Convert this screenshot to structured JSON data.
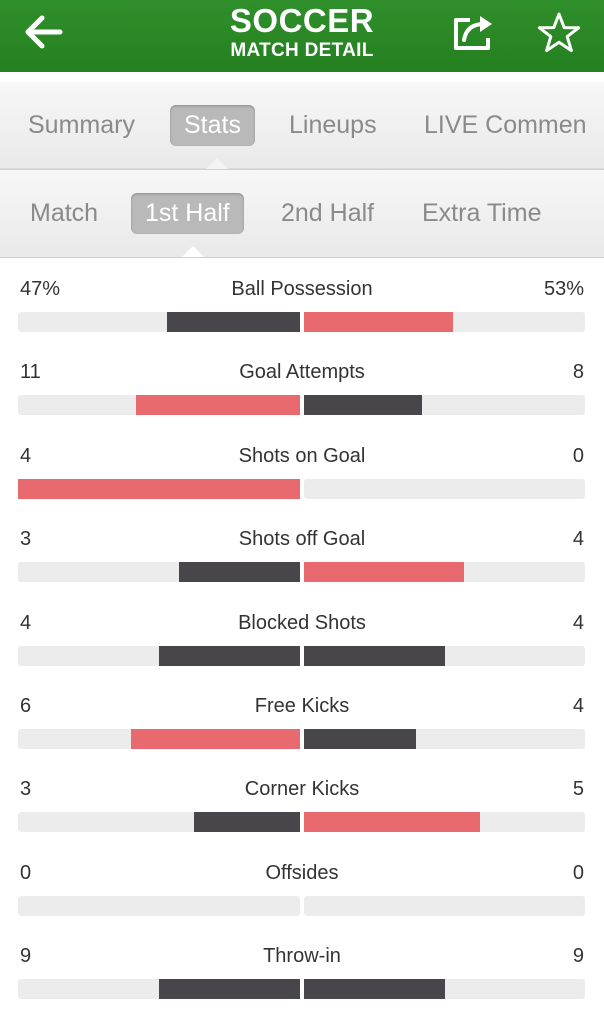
{
  "header": {
    "title": "SOCCER",
    "subtitle": "MATCH DETAIL",
    "icons": [
      "back-arrow-icon",
      "share-icon",
      "star-icon"
    ]
  },
  "tabs": [
    {
      "label": "Summary",
      "active": false
    },
    {
      "label": "Stats",
      "active": true
    },
    {
      "label": "Lineups",
      "active": false
    },
    {
      "label": "LIVE Commen",
      "active": false
    }
  ],
  "periods": [
    {
      "label": "Match",
      "active": false
    },
    {
      "label": "1st Half",
      "active": true
    },
    {
      "label": "2nd Half",
      "active": false
    },
    {
      "label": "Extra Time",
      "active": false
    }
  ],
  "colors": {
    "header_green": "#2a8a25",
    "bar_dark": "#48464a",
    "bar_red": "#e86a6e",
    "track": "#ececec"
  },
  "stats": [
    {
      "label": "Ball Possession",
      "left": "47%",
      "right": "53%",
      "left_fill": 0.47,
      "right_fill": 0.53,
      "left_color": "dark",
      "right_color": "red"
    },
    {
      "label": "Goal Attempts",
      "left": "11",
      "right": "8",
      "left_fill": 0.58,
      "right_fill": 0.42,
      "left_color": "red",
      "right_color": "dark"
    },
    {
      "label": "Shots on Goal",
      "left": "4",
      "right": "0",
      "left_fill": 1.0,
      "right_fill": 0.0,
      "left_color": "red",
      "right_color": "dark"
    },
    {
      "label": "Shots off Goal",
      "left": "3",
      "right": "4",
      "left_fill": 0.43,
      "right_fill": 0.57,
      "left_color": "dark",
      "right_color": "red"
    },
    {
      "label": "Blocked Shots",
      "left": "4",
      "right": "4",
      "left_fill": 0.5,
      "right_fill": 0.5,
      "left_color": "dark",
      "right_color": "dark"
    },
    {
      "label": "Free Kicks",
      "left": "6",
      "right": "4",
      "left_fill": 0.6,
      "right_fill": 0.4,
      "left_color": "red",
      "right_color": "dark"
    },
    {
      "label": "Corner Kicks",
      "left": "3",
      "right": "5",
      "left_fill": 0.375,
      "right_fill": 0.625,
      "left_color": "dark",
      "right_color": "red"
    },
    {
      "label": "Offsides",
      "left": "0",
      "right": "0",
      "left_fill": 0.0,
      "right_fill": 0.0,
      "left_color": "dark",
      "right_color": "dark"
    },
    {
      "label": "Throw-in",
      "left": "9",
      "right": "9",
      "left_fill": 0.5,
      "right_fill": 0.5,
      "left_color": "dark",
      "right_color": "dark"
    }
  ]
}
